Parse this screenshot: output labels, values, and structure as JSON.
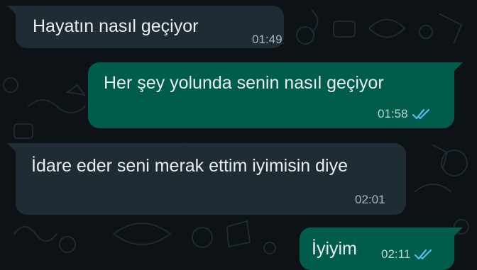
{
  "colors": {
    "chat_background": "#0c1216",
    "incoming_bubble": "#202c33",
    "outgoing_bubble": "#005c4b",
    "message_text": "#e9edef",
    "read_ticks": "#53bdeb"
  },
  "messages": [
    {
      "direction": "incoming",
      "text": "Hayatın nasıl geçiyor",
      "time": "01:49"
    },
    {
      "direction": "outgoing",
      "text": "Her şey yolunda senin nasıl geçiyor",
      "time": "01:58",
      "status_icon": "double-check-read-icon"
    },
    {
      "direction": "incoming",
      "text": "İdare eder seni merak ettim iyimisin diye",
      "time": "02:01"
    },
    {
      "direction": "outgoing",
      "text": "İyiyim",
      "time": "02:11",
      "status_icon": "double-check-read-icon"
    }
  ]
}
